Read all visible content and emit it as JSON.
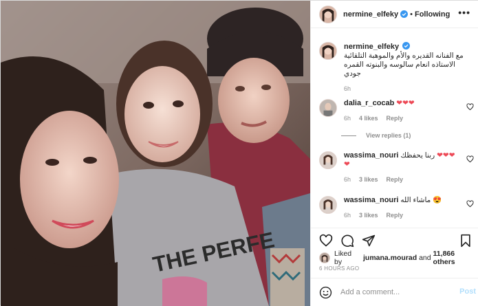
{
  "post": {
    "author": "nermine_elfeky",
    "follow_status": "Following",
    "more_label": "•••"
  },
  "caption": {
    "username": "nermine_elfeky",
    "text": "مع الفنانه القديره والأم والموهبة التلقائية الاستاذه انعام سالوسه والبنوته القمره جودي",
    "time": "6h"
  },
  "comments": [
    {
      "username": "dalia_r_cocab",
      "text": "",
      "hearts": "❤❤❤",
      "time": "6h",
      "likes": "4 likes",
      "reply": "Reply",
      "view_replies": "View replies (1)"
    },
    {
      "username": "wassima_nouri",
      "text": "ربنا يحفظك",
      "hearts": "❤❤❤❤",
      "time": "6h",
      "likes": "3 likes",
      "reply": "Reply"
    },
    {
      "username": "wassima_nouri",
      "text": "ماشاء الله",
      "hearts": "",
      "emoji": "😍",
      "time": "6h",
      "likes": "3 likes",
      "reply": "Reply"
    }
  ],
  "liked_by": {
    "prefix": "Liked by",
    "user": "jumana.mourad",
    "conj": "and",
    "count": "11,866 others"
  },
  "timestamp": "6 HOURS AGO",
  "add_comment": {
    "placeholder": "Add a comment...",
    "post_label": "Post"
  },
  "photo": {
    "shirt_text": "THE PERFE"
  },
  "colors": {
    "heart": "#ed4956",
    "verified": "#3897f0",
    "muted": "#8e8e8e",
    "post_disabled": "#b2dffc"
  },
  "icons": [
    "verified-badge-icon",
    "heart-icon",
    "comment-icon",
    "share-icon",
    "bookmark-icon",
    "emoji-icon",
    "more-options-icon"
  ]
}
